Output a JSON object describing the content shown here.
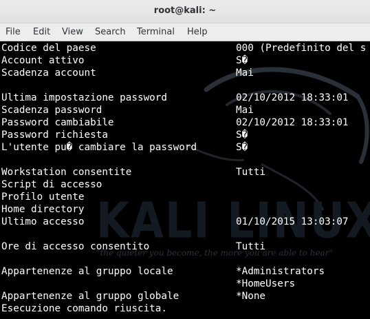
{
  "window": {
    "title": "root@kali: ~"
  },
  "menu": {
    "items": [
      "File",
      "Edit",
      "View",
      "Search",
      "Terminal",
      "Help"
    ]
  },
  "watermark": {
    "logo_text": "KALI LINUX",
    "tagline": "\"the quieter you become, the more you are able to hear\""
  },
  "terminal": {
    "lines": [
      {
        "label": "Codice del paese",
        "value": "000 (Predefinito del s"
      },
      {
        "label": "Account attivo",
        "value": "S�"
      },
      {
        "label": "Scadenza account",
        "value": "Mai"
      },
      {
        "label": "",
        "value": ""
      },
      {
        "label": "Ultima impostazione password",
        "value": "02/10/2012 18:33:01"
      },
      {
        "label": "Scadenza password",
        "value": "Mai"
      },
      {
        "label": "Password cambiabile",
        "value": "02/10/2012 18:33:01"
      },
      {
        "label": "Password richiesta",
        "value": "S�"
      },
      {
        "label": "L'utente pu� cambiare la password",
        "value": "S�"
      },
      {
        "label": "",
        "value": ""
      },
      {
        "label": "Workstation consentite",
        "value": "Tutti"
      },
      {
        "label": "Script di accesso",
        "value": ""
      },
      {
        "label": "Profilo utente",
        "value": ""
      },
      {
        "label": "Home directory",
        "value": ""
      },
      {
        "label": "Ultimo accesso",
        "value": "01/10/2015 13:03:07"
      },
      {
        "label": "",
        "value": ""
      },
      {
        "label": "Ore di accesso consentito",
        "value": "Tutti"
      },
      {
        "label": "",
        "value": ""
      },
      {
        "label": "Appartenenze al gruppo locale",
        "value": "*Administrators"
      },
      {
        "label": "",
        "value": "*HomeUsers"
      },
      {
        "label": "Appartenenze al gruppo globale",
        "value": "*None"
      },
      {
        "label": "Esecuzione comando riuscita.",
        "value": ""
      }
    ]
  }
}
